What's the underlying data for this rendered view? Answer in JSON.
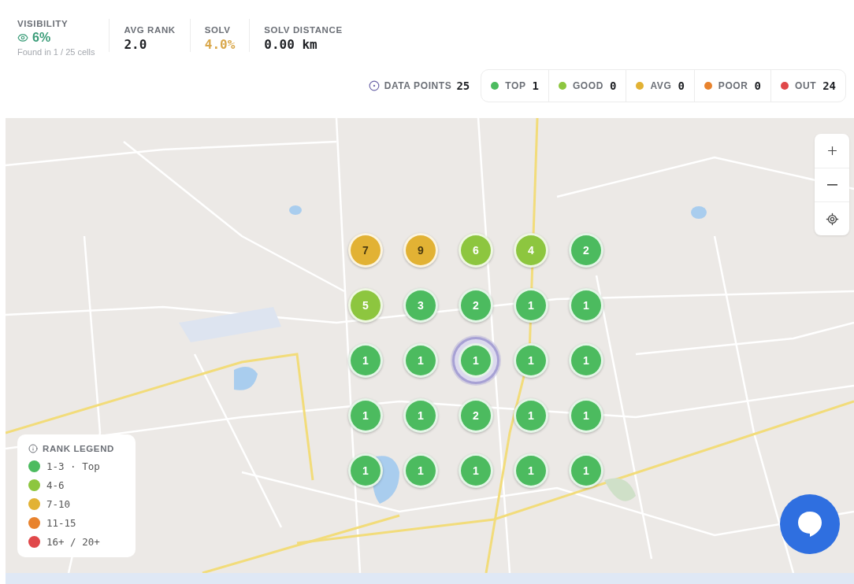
{
  "stats": [
    {
      "kind": "visibility",
      "label": "VISIBILITY",
      "value": "6%",
      "note": "Found in 1 / 25 cells"
    },
    {
      "kind": "plain",
      "label": "AVG RANK",
      "value": "2.0"
    },
    {
      "kind": "warn",
      "label": "SOLV",
      "value": "4.0%"
    },
    {
      "kind": "plain",
      "label": "SOLV DISTANCE",
      "value": "0.00 km"
    }
  ],
  "data_points": {
    "label": "DATA POINTS",
    "count": "25"
  },
  "buckets": [
    {
      "label": "TOP",
      "count": "1",
      "color": "#4cbb5f"
    },
    {
      "label": "GOOD",
      "count": "0",
      "color": "#8dc63f"
    },
    {
      "label": "AVG",
      "count": "0",
      "color": "#e2b234"
    },
    {
      "label": "POOR",
      "count": "0",
      "color": "#e8832e"
    },
    {
      "label": "OUT",
      "count": "24",
      "color": "#e0484a"
    }
  ],
  "markers": [
    {
      "rank": "7",
      "color": "#e2b234",
      "selected": false
    },
    {
      "rank": "9",
      "color": "#e2b234",
      "selected": false
    },
    {
      "rank": "6",
      "color": "#8dc63f",
      "selected": false
    },
    {
      "rank": "4",
      "color": "#8dc63f",
      "selected": false
    },
    {
      "rank": "2",
      "color": "#4cbb5f",
      "selected": false
    },
    {
      "rank": "5",
      "color": "#8dc63f",
      "selected": false
    },
    {
      "rank": "3",
      "color": "#4cbb5f",
      "selected": false
    },
    {
      "rank": "2",
      "color": "#4cbb5f",
      "selected": false
    },
    {
      "rank": "1",
      "color": "#4cbb5f",
      "selected": false
    },
    {
      "rank": "1",
      "color": "#4cbb5f",
      "selected": false
    },
    {
      "rank": "1",
      "color": "#4cbb5f",
      "selected": false
    },
    {
      "rank": "1",
      "color": "#4cbb5f",
      "selected": false
    },
    {
      "rank": "1",
      "color": "#4cbb5f",
      "selected": true
    },
    {
      "rank": "1",
      "color": "#4cbb5f",
      "selected": false
    },
    {
      "rank": "1",
      "color": "#4cbb5f",
      "selected": false
    },
    {
      "rank": "1",
      "color": "#4cbb5f",
      "selected": false
    },
    {
      "rank": "1",
      "color": "#4cbb5f",
      "selected": false
    },
    {
      "rank": "2",
      "color": "#4cbb5f",
      "selected": false
    },
    {
      "rank": "1",
      "color": "#4cbb5f",
      "selected": false
    },
    {
      "rank": "1",
      "color": "#4cbb5f",
      "selected": false
    },
    {
      "rank": "1",
      "color": "#4cbb5f",
      "selected": false
    },
    {
      "rank": "1",
      "color": "#4cbb5f",
      "selected": false
    },
    {
      "rank": "1",
      "color": "#4cbb5f",
      "selected": false
    },
    {
      "rank": "1",
      "color": "#4cbb5f",
      "selected": false
    },
    {
      "rank": "1",
      "color": "#4cbb5f",
      "selected": false
    }
  ],
  "legend": {
    "title": "RANK LEGEND",
    "items": [
      {
        "label": "1-3 · Top",
        "color": "#4cbb5f"
      },
      {
        "label": "4-6",
        "color": "#8dc63f"
      },
      {
        "label": "7-10",
        "color": "#e2b234"
      },
      {
        "label": "11-15",
        "color": "#e8832e"
      },
      {
        "label": "16+ / 20+",
        "color": "#e0484a"
      }
    ]
  }
}
